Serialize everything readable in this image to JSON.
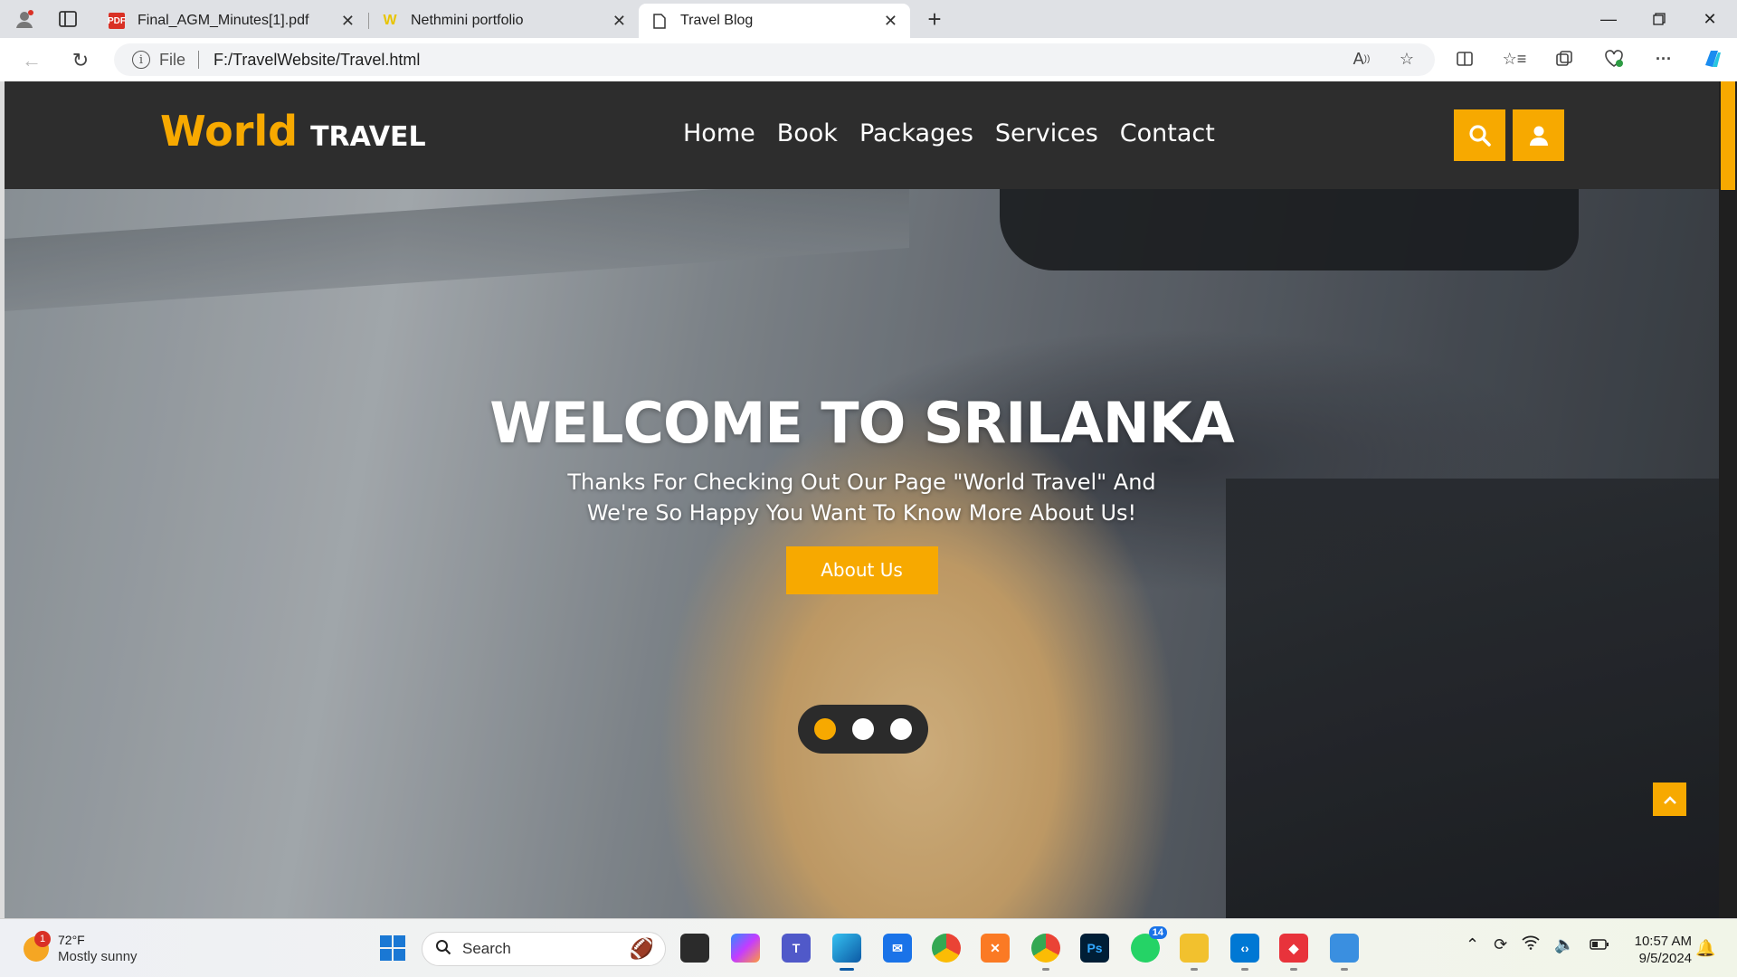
{
  "browser": {
    "tabs": [
      {
        "title": "Final_AGM_Minutes[1].pdf",
        "favicon": "PDF",
        "active": false
      },
      {
        "title": "Nethmini portfolio",
        "favicon": "W",
        "active": false
      },
      {
        "title": "Travel Blog",
        "favicon": "page-icon",
        "active": true
      }
    ],
    "address": {
      "scheme_label": "File",
      "url": "F:/TravelWebsite/Travel.html"
    }
  },
  "site": {
    "logo": {
      "word1": "World",
      "word2": "TRAVEL"
    },
    "nav": [
      "Home",
      "Book",
      "Packages",
      "Services",
      "Contact"
    ],
    "hero": {
      "title": "WELCOME TO SRILANKA",
      "text_line1": "Thanks For Checking Out Our Page \"World Travel\" And",
      "text_line2": "We're So Happy You Want To Know More About Us!",
      "button": "About Us"
    },
    "slider": {
      "count": 3,
      "active_index": 0
    },
    "colors": {
      "accent": "#f7a900",
      "header_bg": "#2d2d2d"
    }
  },
  "taskbar": {
    "weather": {
      "temp": "72°F",
      "condition": "Mostly sunny",
      "badge": "1"
    },
    "search_label": "Search",
    "whatsapp_badge": "14",
    "clock": {
      "time": "10:57 AM",
      "date": "9/5/2024"
    }
  }
}
